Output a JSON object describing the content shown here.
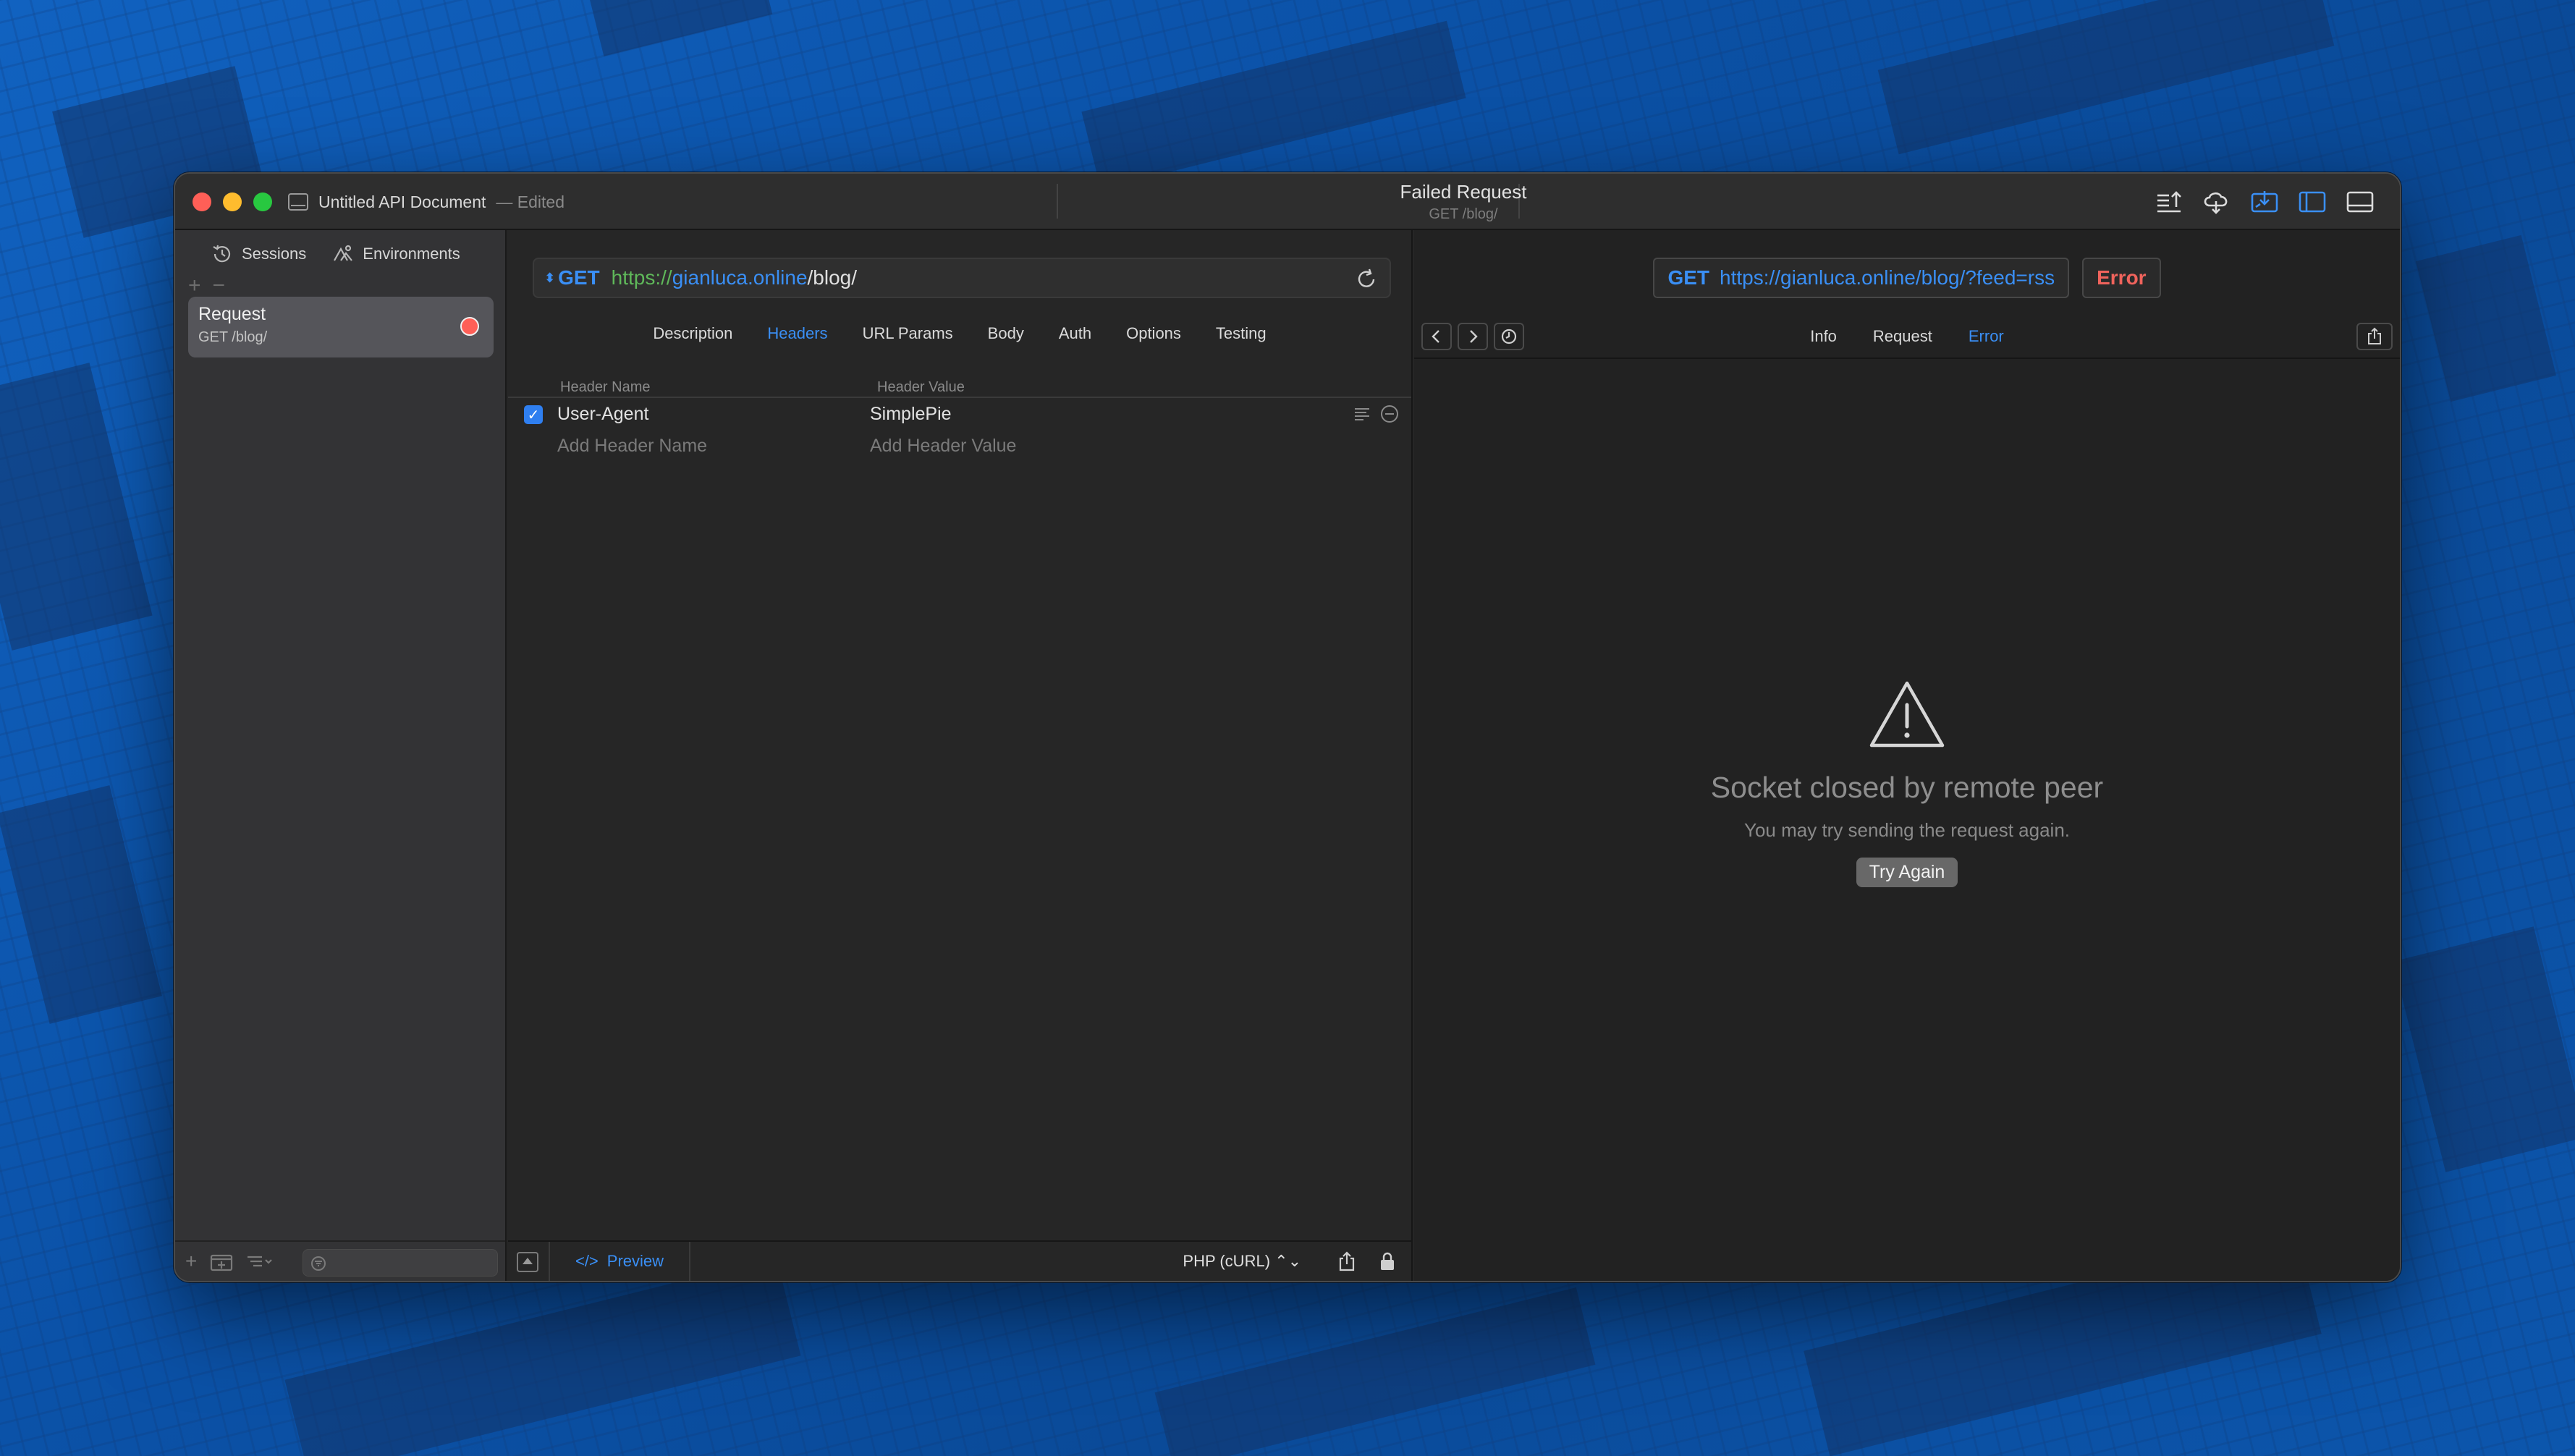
{
  "window": {
    "document_title": "Untitled API Document",
    "document_status": "— Edited",
    "center_title": "Failed Request",
    "center_subtitle": "GET /blog/"
  },
  "toolbar_icons": [
    "export-icon",
    "cloud-sync-icon",
    "import-icon",
    "sidebar-toggle-icon",
    "bottom-panel-icon"
  ],
  "sidebar": {
    "tabs": [
      {
        "label": "Sessions",
        "icon": "history-icon"
      },
      {
        "label": "Environments",
        "icon": "environments-icon"
      }
    ],
    "items": [
      {
        "name": "Request",
        "path": "GET /blog/",
        "status": "error",
        "status_color": "#fe5f57"
      }
    ]
  },
  "request": {
    "method": "GET",
    "url_scheme": "https://",
    "url_host": "gianluca.online",
    "url_path": "/blog/",
    "tabs": [
      "Description",
      "Headers",
      "URL Params",
      "Body",
      "Auth",
      "Options",
      "Testing"
    ],
    "active_tab": "Headers",
    "headers_table": {
      "columns": [
        "Header Name",
        "Header Value"
      ],
      "rows": [
        {
          "enabled": true,
          "name": "User-Agent",
          "value": "SimplePie"
        }
      ],
      "placeholder_name": "Add Header Name",
      "placeholder_value": "Add Header Value"
    },
    "bottom": {
      "preview_label": "Preview",
      "code_language": "PHP (cURL) ⌃⌄"
    }
  },
  "response": {
    "method": "GET",
    "url": "https://gianluca.online/blog/?feed=rss",
    "status_label": "Error",
    "tabs": [
      "Info",
      "Request",
      "Error"
    ],
    "active_tab": "Error",
    "error": {
      "title": "Socket closed by remote peer",
      "subtitle": "You may try sending the request again.",
      "button": "Try Again"
    }
  },
  "colors": {
    "accent": "#3a8ff5",
    "error": "#f0635c",
    "scheme": "#5fb85a"
  }
}
